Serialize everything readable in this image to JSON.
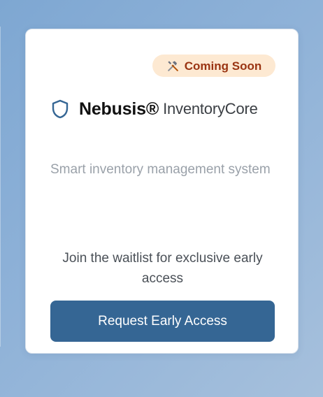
{
  "badge": {
    "icon": "hammer-wrench-icon",
    "label": "Coming Soon"
  },
  "brand": {
    "icon": "shield-icon",
    "name": "Nebusis®",
    "product": "InventoryCore"
  },
  "tagline": "Smart inventory management system",
  "waitlist": "Join the waitlist for exclusive early access",
  "cta": {
    "label": "Request Early Access"
  },
  "colors": {
    "accent": "#356694",
    "badge_bg": "#fde9d2",
    "badge_text": "#9a3412"
  }
}
